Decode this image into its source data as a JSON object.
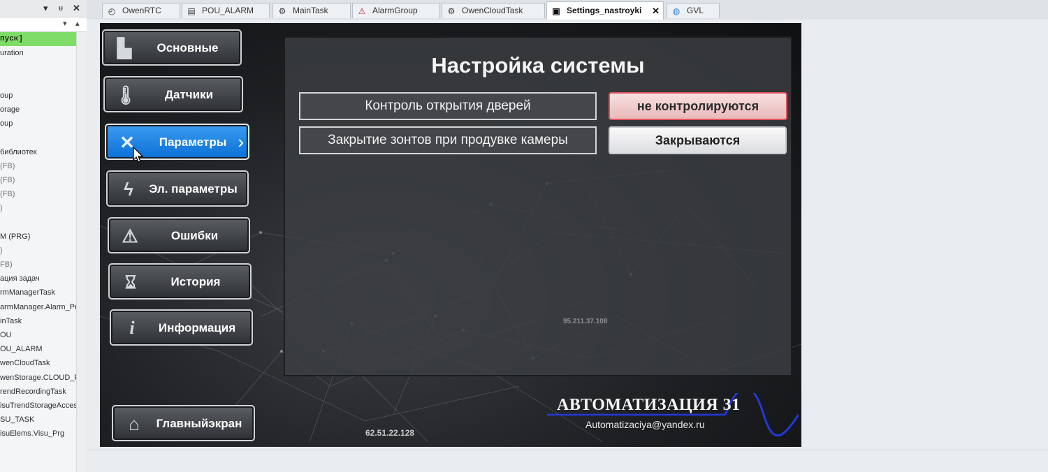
{
  "tree": {
    "header_icons": [
      "chevron-down-icon",
      "pin-icon",
      "close-icon"
    ],
    "selected_item": "пуск]",
    "items": [
      "uration",
      "",
      "",
      "oup",
      "orage",
      "oup",
      "",
      "библиотек",
      "(FB)",
      "(FB)",
      "(FB)",
      ")",
      "",
      "M (PRG)",
      ")",
      "FB)",
      "ация задач",
      "rmManagerTask",
      "armManager.Alarm_Prg",
      "inTask",
      "OU",
      "OU_ALARM",
      "wenCloudTask",
      "wenStorage.CLOUD_PR",
      "rendRecordingTask",
      "isuTrendStorageAccess",
      "SU_TASK",
      "isuElems.Visu_Prg"
    ]
  },
  "tabs": [
    {
      "label": "OwenRTC",
      "icon": "clock-icon"
    },
    {
      "label": "POU_ALARM",
      "icon": "document-icon"
    },
    {
      "label": "MainTask",
      "icon": "task-icon"
    },
    {
      "label": "AlarmGroup",
      "icon": "alarm-triangle-icon"
    },
    {
      "label": "OwenCloudTask",
      "icon": "task-icon"
    },
    {
      "label": "Settings_nastroyki",
      "icon": "visu-icon",
      "active": true,
      "close": "✕"
    },
    {
      "label": "GVL",
      "icon": "globe-icon"
    }
  ],
  "nav": [
    {
      "label": "Основные",
      "icon": "main-icon"
    },
    {
      "label": "Датчики",
      "icon": "thermometer-icon"
    },
    {
      "label": "Параметры",
      "icon": "tools-icon",
      "active": true,
      "chevron": "›"
    },
    {
      "label": "Эл. параметры",
      "icon": "lightning-icon"
    },
    {
      "label": "Ошибки",
      "icon": "warning-icon"
    },
    {
      "label": "История",
      "icon": "hourglass-icon"
    },
    {
      "label": "Информация",
      "icon": "info-icon"
    }
  ],
  "home_button": {
    "label_line1": "Главный",
    "label_line2": "экран",
    "icon": "home-icon"
  },
  "panel": {
    "title": "Настройка системы",
    "settings": [
      {
        "label": "Контроль открытия дверей",
        "value": "не контролируются",
        "state": "red"
      },
      {
        "label": "Закрытие зонтов при продувке камеры",
        "value": "Закрываются",
        "state": "white"
      }
    ]
  },
  "ip_center": "95.211.37.108",
  "ip_bottom": "62.51.22.128",
  "brand": {
    "name": "АВТОМАТИЗАЦИЯ 31",
    "email": "Automatizaciya@yandex.ru"
  },
  "colors": {
    "active_button": "#0a6fd6",
    "alert_value_border": "#e2525c",
    "tree_selected": "#7fdc68",
    "brand_wave": "#2438d8"
  }
}
